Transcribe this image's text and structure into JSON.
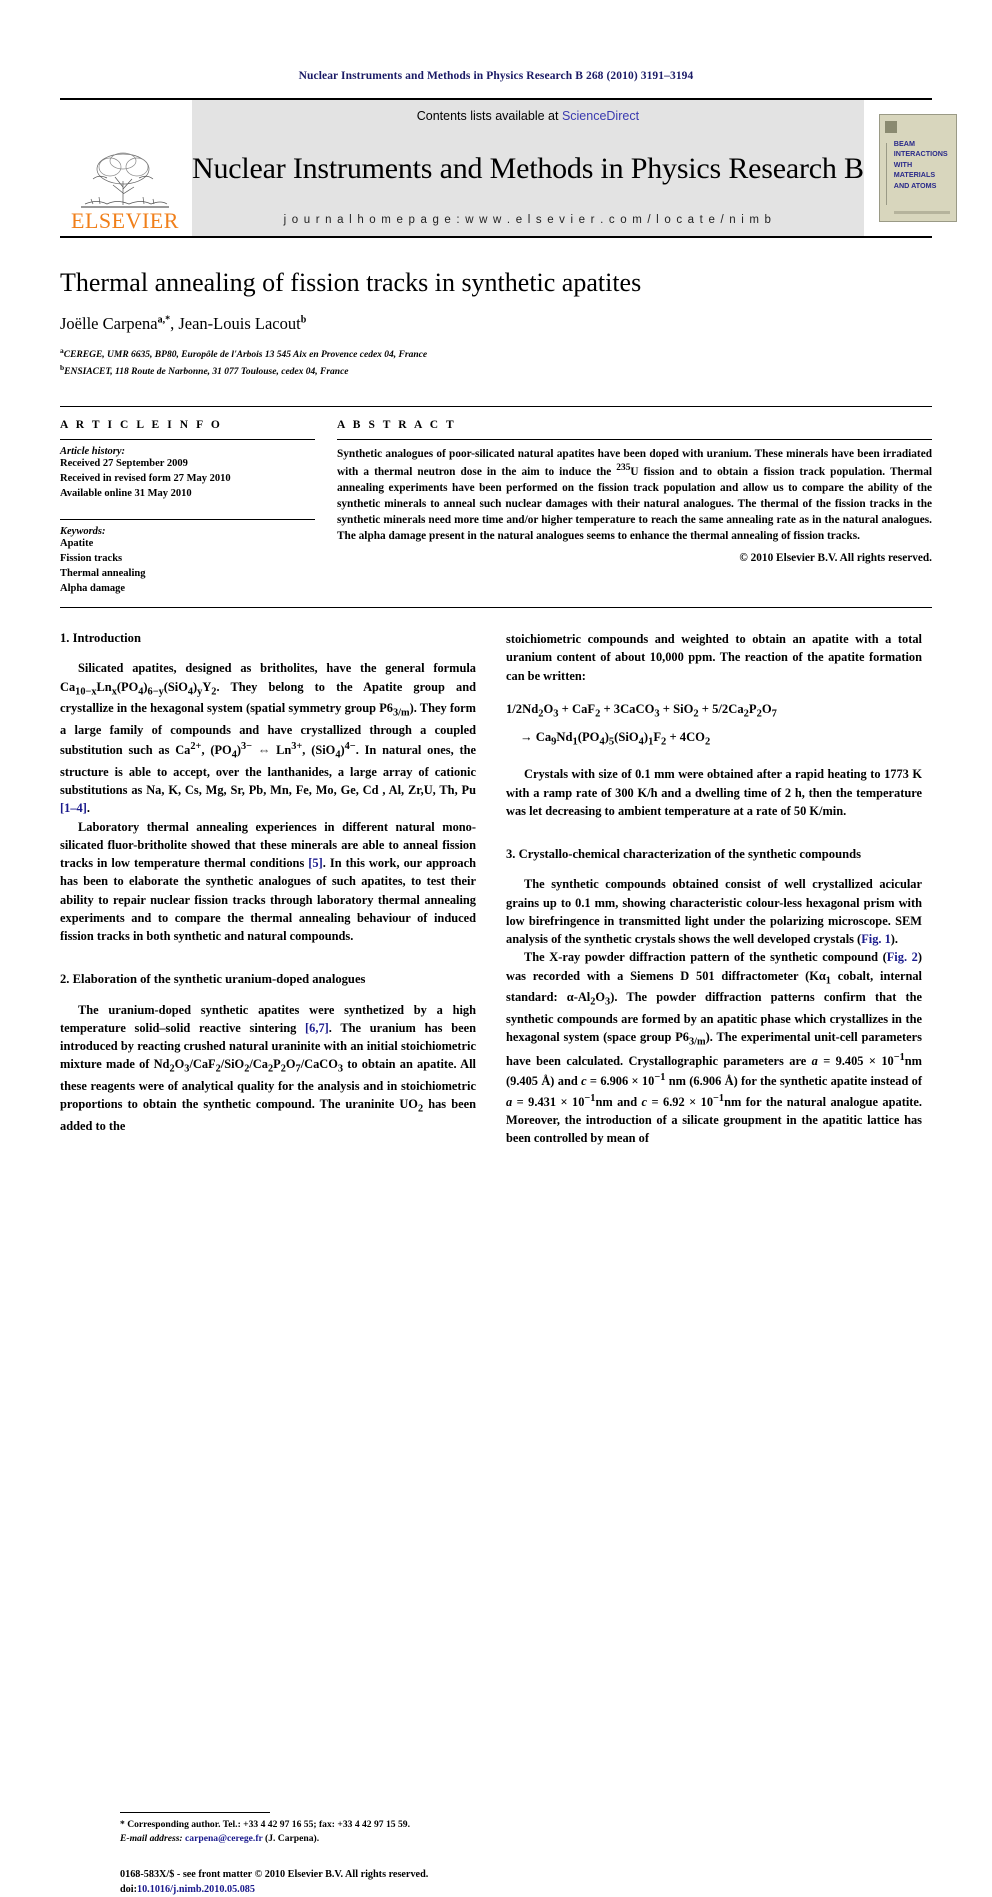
{
  "running_head": "Nuclear Instruments and Methods in Physics Research B 268 (2010) 3191–3194",
  "masthead": {
    "contents_prefix": "Contents lists available at ",
    "sciencedirect": "ScienceDirect",
    "journal_title": "Nuclear Instruments and Methods in Physics Research B",
    "homepage": "j o u r n a l   h o m e p a g e :   w w w . e l s e v i e r . c o m / l o c a t e / n i m b",
    "publisher": "ELSEVIER",
    "cover_lines": [
      "BEAM",
      "INTERACTIONS",
      "WITH",
      "MATERIALS",
      "AND ATOMS"
    ],
    "link_color": "#3a3ab0",
    "publisher_color": "#f07f1a",
    "band_color": "#e3e3e3"
  },
  "article": {
    "title": "Thermal annealing of fission tracks in synthetic apatites",
    "authors": "Joëlle Carpena",
    "author_sup_a": "a,*",
    "authors2": ", Jean-Louis Lacout",
    "author_sup_b": "b",
    "affiliation_a": "CEREGE, UMR 6635, BP80, Europôle de l'Arbois 13 545 Aix en Provence cedex 04, France",
    "affiliation_b": "ENSIACET, 118 Route de Narbonne, 31 077 Toulouse, cedex 04, France"
  },
  "article_info": {
    "heading": "A R T I C L E   I N F O",
    "history_label": "Article history:",
    "history": [
      "Received 27 September 2009",
      "Received in revised form 27 May 2010",
      "Available online 31 May 2010"
    ],
    "keywords_label": "Keywords:",
    "keywords": [
      "Apatite",
      "Fission tracks",
      "Thermal annealing",
      "Alpha damage"
    ]
  },
  "abstract": {
    "heading": "A B S T R A C T",
    "text": "Synthetic analogues of poor-silicated natural apatites have been doped with uranium. These minerals have been irradiated with a thermal neutron dose in the aim to induce the 235U fission and to obtain a fission track population. Thermal annealing experiments have been performed on the fission track population and allow us to compare the ability of the synthetic minerals to anneal such nuclear damages with their natural analogues. The thermal of the fission tracks in the synthetic minerals need more time and/or higher temperature to reach the same annealing rate as in the natural analogues. The alpha damage present in the natural analogues seems to enhance the thermal annealing of fission tracks.",
    "copyright": "© 2010 Elsevier B.V. All rights reserved."
  },
  "sections": {
    "s1_heading": "1. Introduction",
    "s1_p1": "Silicated apatites, designed as britholites, have the general formula Ca10−xLnx(PO4)6−y(SiO4)yY2. They belong to the Apatite group and crystallize in the hexagonal system (spatial symmetry group P63/m). They form a large family of compounds and have crystallized through a coupled substitution such as Ca2+, (PO4)3− ⇔ Ln3+, (SiO4)4−. In natural ones, the structure is able to accept, over the lanthanides, a large array of cationic substitutions as Na, K, Cs, Mg, Sr, Pb, Mn, Fe, Mo, Ge, Cd , Al, Zr,U, Th, Pu [1–4].",
    "s1_p2": "Laboratory thermal annealing experiences in different natural mono-silicated fluor-britholite showed that these minerals are able to anneal fission tracks in low temperature thermal conditions [5]. In this work, our approach has been to elaborate the synthetic analogues of such apatites, to test their ability to repair nuclear fission tracks through laboratory thermal annealing experiments and to compare the thermal annealing behaviour of induced fission tracks in both synthetic and natural compounds.",
    "s2_heading": "2. Elaboration of the synthetic uranium-doped analogues",
    "s2_p1": "The uranium-doped synthetic apatites were synthetized by a high temperature solid–solid reactive sintering [6,7]. The uranium has been introduced by reacting crushed natural uraninite with an initial stoichiometric mixture made of Nd2O3/CaF2/SiO2/Ca2P2O7/CaCO3 to obtain an apatite. All these reagents were of analytical quality for the analysis and in stoichiometric proportions to obtain the synthetic compound. The uraninite UO2 has been added to the",
    "s2_p1_cont": "stoichiometric compounds and weighted to obtain an apatite with a total uranium content of about 10,000 ppm. The reaction of the apatite formation can be written:",
    "equation_1": "1/2Nd2O3 + CaF2 + 3CaCO3 + SiO2 + 5/2Ca2P2O7",
    "equation_2": "→ Ca9Nd1(PO4)5(SiO4)1F2 + 4CO2",
    "s2_p2": "Crystals with size of 0.1 mm were obtained after a rapid heating to 1773 K with a ramp rate of 300 K/h and a dwelling time of 2 h, then the temperature was let decreasing to ambient temperature at a rate of 50 K/min.",
    "s3_heading": "3. Crystallo-chemical characterization of the synthetic compounds",
    "s3_p1": "The synthetic compounds obtained consist of well crystallized acicular grains up to 0.1 mm, showing characteristic colour-less hexagonal prism with low birefringence in transmitted light under the polarizing microscope. SEM analysis of the synthetic crystals shows the well developed crystals (Fig. 1).",
    "s3_p2": "The X-ray powder diffraction pattern of the synthetic compound (Fig. 2) was recorded with a Siemens D 501 diffractometer (Kα1 cobalt, internal standard: α-Al2O3). The powder diffraction patterns confirm that the synthetic compounds are formed by an apatitic phase which crystallizes in the hexagonal system (space group P63/m). The experimental unit-cell parameters have been calculated. Crystallographic parameters are a = 9.405 × 10−1nm (9.405 Å) and c = 6.906 × 10−1 nm (6.906 Å) for the synthetic apatite instead of a = 9.431 × 10−1nm and c = 6.92 × 10−1nm for the natural analogue apatite. Moreover, the introduction of a silicate groupment in the apatitic lattice has been controlled by mean of"
  },
  "footnote": {
    "marker": "*",
    "corresponding": "Corresponding author. Tel.: +33 4 42 97 16 55; fax: +33 4 42 97 15 59.",
    "email_label": "E-mail address:",
    "email": "carpena@cerege.fr",
    "email_suffix": "(J. Carpena)."
  },
  "footer": {
    "issn_line": "0168-583X/$ - see front matter © 2010 Elsevier B.V. All rights reserved.",
    "doi_label": "doi:",
    "doi": "10.1016/j.nimb.2010.05.085"
  }
}
